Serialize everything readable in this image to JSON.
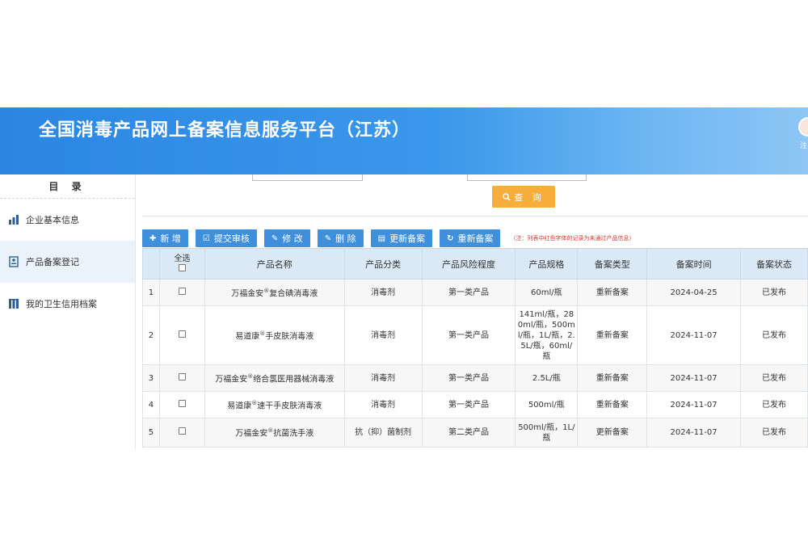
{
  "header": {
    "title": "全国消毒产品网上备案信息服务平台（江苏）",
    "user_label": "注"
  },
  "sidebar": {
    "title": "目 录",
    "items": [
      {
        "label": "企业基本信息",
        "icon": "bar-chart-icon",
        "active": false
      },
      {
        "label": "产品备案登记",
        "icon": "id-card-icon",
        "active": true
      },
      {
        "label": "我的卫生信用档案",
        "icon": "archive-icon",
        "active": false
      }
    ]
  },
  "search": {
    "query_label": "查 询"
  },
  "toolbar": {
    "buttons": [
      {
        "label": "新 增",
        "icon": "plus-icon"
      },
      {
        "label": "提交审核",
        "icon": "check-icon"
      },
      {
        "label": "修 改",
        "icon": "edit-icon"
      },
      {
        "label": "删 除",
        "icon": "edit-icon"
      },
      {
        "label": "更新备案",
        "icon": "file-icon"
      },
      {
        "label": "重新备案",
        "icon": "refresh-icon"
      }
    ],
    "note": "（注：列表中红色字体的记录为未通过产品信息）"
  },
  "table": {
    "headers": [
      "",
      "全选",
      "产品名称",
      "产品分类",
      "产品风险程度",
      "产品规格",
      "备案类型",
      "备案时间",
      "备案状态"
    ],
    "rows": [
      {
        "no": "1",
        "name": "万福金安",
        "name_suffix": "复合碘消毒液",
        "category": "消毒剂",
        "risk": "第一类产品",
        "spec": "60ml/瓶",
        "type": "重新备案",
        "date": "2024-04-25",
        "status": "已发布"
      },
      {
        "no": "2",
        "name": "易道康",
        "name_suffix": "手皮肤消毒液",
        "category": "消毒剂",
        "risk": "第一类产品",
        "spec": "141ml/瓶，280ml/瓶，500ml/瓶，1L/瓶，2.5L/瓶，60ml/瓶",
        "type": "重新备案",
        "date": "2024-11-07",
        "status": "已发布"
      },
      {
        "no": "3",
        "name": "万福金安",
        "name_suffix": "络合氯医用器械消毒液",
        "category": "消毒剂",
        "risk": "第一类产品",
        "spec": "2.5L/瓶",
        "type": "重新备案",
        "date": "2024-11-07",
        "status": "已发布"
      },
      {
        "no": "4",
        "name": "易道康",
        "name_suffix": "速干手皮肤消毒液",
        "category": "消毒剂",
        "risk": "第一类产品",
        "spec": "500ml/瓶",
        "type": "重新备案",
        "date": "2024-11-07",
        "status": "已发布"
      },
      {
        "no": "5",
        "name": "万福金安",
        "name_suffix": "抗菌洗手液",
        "category": "抗（抑）菌制剂",
        "risk": "第二类产品",
        "spec": "500ml/瓶，1L/瓶",
        "type": "更新备案",
        "date": "2024-11-07",
        "status": "已发布"
      }
    ],
    "registered_mark": "®"
  },
  "colors": {
    "header_blue": "#3b98ea",
    "button_blue": "#3e8fdc",
    "query_orange": "#f6ad3c",
    "note_red": "#d23a2a"
  }
}
